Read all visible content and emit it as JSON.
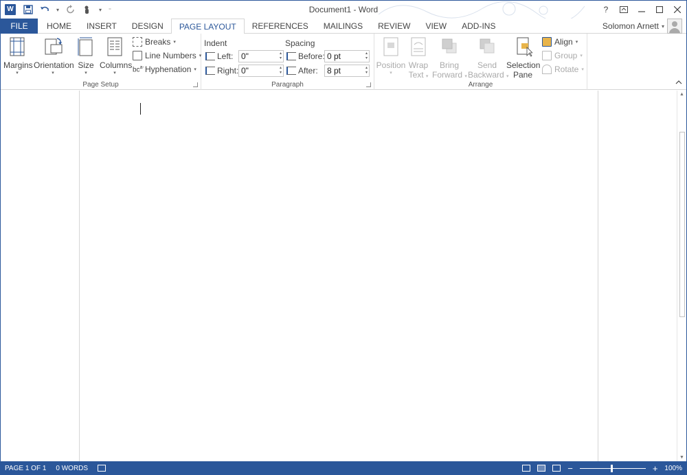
{
  "window": {
    "title": "Document1 - Word",
    "logo_letter": "W",
    "help": "?",
    "controls": [
      "restore-ribbon",
      "minimize",
      "maximize",
      "close"
    ]
  },
  "qat": {
    "save_icon": "save-icon",
    "undo_icon": "undo-icon",
    "redo_icon": "redo-icon",
    "touch_icon": "touch-mode-icon"
  },
  "tabs": {
    "file": "FILE",
    "items": [
      "HOME",
      "INSERT",
      "DESIGN",
      "PAGE LAYOUT",
      "REFERENCES",
      "MAILINGS",
      "REVIEW",
      "VIEW",
      "ADD-INS"
    ],
    "active": "PAGE LAYOUT"
  },
  "user": {
    "name": "Solomon Arnett"
  },
  "ribbon": {
    "page_setup": {
      "label": "Page Setup",
      "margins": "Margins",
      "orientation": "Orientation",
      "size": "Size",
      "columns": "Columns",
      "breaks": "Breaks",
      "line_numbers": "Line Numbers",
      "hyphenation": "Hyphenation"
    },
    "paragraph": {
      "label": "Paragraph",
      "indent_head": "Indent",
      "spacing_head": "Spacing",
      "left_label": "Left:",
      "left_value": "0\"",
      "right_label": "Right:",
      "right_value": "0\"",
      "before_label": "Before:",
      "before_value": "0 pt",
      "after_label": "After:",
      "after_value": "8 pt"
    },
    "arrange": {
      "label": "Arrange",
      "position": "Position",
      "wrap_1": "Wrap",
      "wrap_2": "Text",
      "bring_1": "Bring",
      "bring_2": "Forward",
      "send_1": "Send",
      "send_2": "Backward",
      "selection_1": "Selection",
      "selection_2": "Pane",
      "align": "Align",
      "group": "Group",
      "rotate": "Rotate"
    }
  },
  "status": {
    "page": "PAGE 1 OF 1",
    "words": "0 WORDS",
    "zoom": "100%",
    "zoom_level": 1.0
  }
}
